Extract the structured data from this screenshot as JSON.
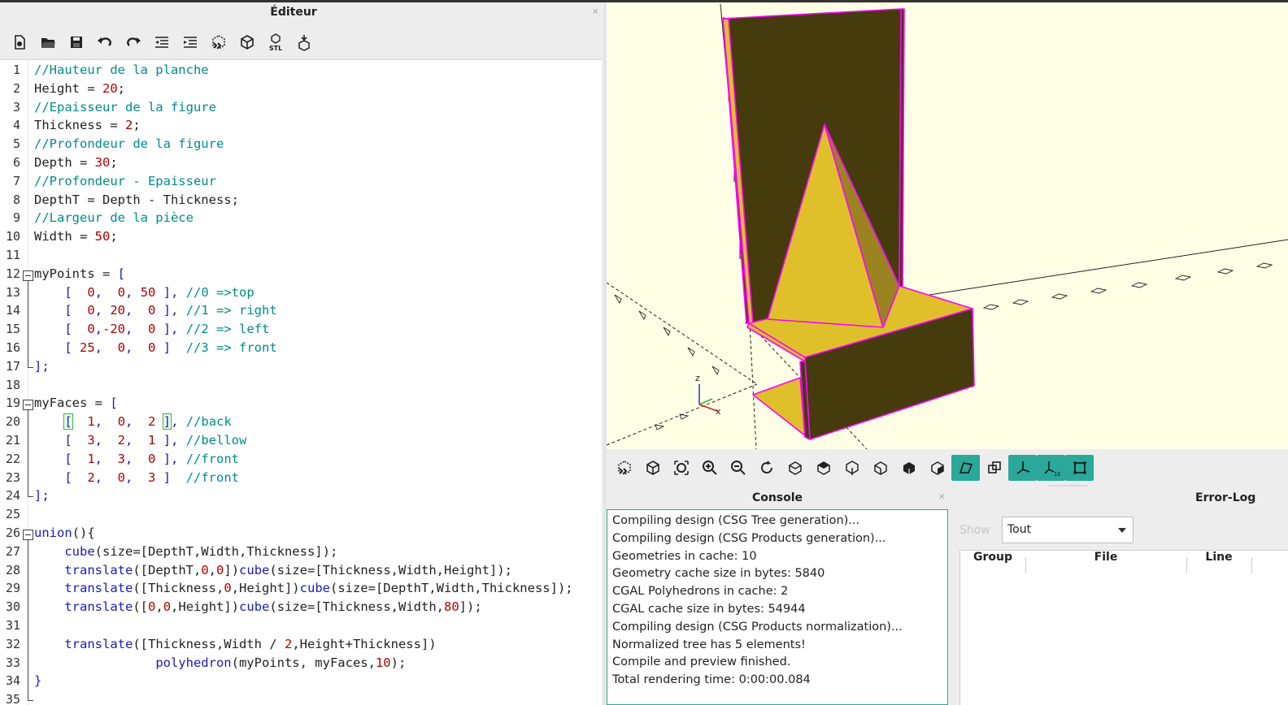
{
  "editor": {
    "title": "Éditeur",
    "close": "×",
    "toolbar": [
      "new-file-icon",
      "open-file-icon",
      "save-icon",
      "undo-icon",
      "redo-icon",
      "unindent-icon",
      "indent-icon",
      "preview-icon",
      "render-icon",
      "export-stl-icon",
      "send-to-print-icon"
    ],
    "stl_label": "STL",
    "lines": [
      {
        "n": "1",
        "segs": [
          [
            "cmt",
            "//Hauteur de la planche"
          ]
        ]
      },
      {
        "n": "2",
        "segs": [
          [
            "",
            "Height = "
          ],
          [
            "num",
            "20"
          ],
          [
            "",
            ";"
          ]
        ]
      },
      {
        "n": "3",
        "segs": [
          [
            "cmt",
            "//Epaisseur de la figure"
          ]
        ]
      },
      {
        "n": "4",
        "segs": [
          [
            "",
            "Thickness = "
          ],
          [
            "num",
            "2"
          ],
          [
            "",
            ";"
          ]
        ]
      },
      {
        "n": "5",
        "segs": [
          [
            "cmt",
            "//Profondeur de la figure"
          ]
        ]
      },
      {
        "n": "6",
        "segs": [
          [
            "",
            "Depth = "
          ],
          [
            "num",
            "30"
          ],
          [
            "",
            ";"
          ]
        ]
      },
      {
        "n": "7",
        "segs": [
          [
            "cmt",
            "//Profondeur - Epaisseur"
          ]
        ]
      },
      {
        "n": "8",
        "segs": [
          [
            "",
            "DepthT = Depth - Thickness;"
          ]
        ]
      },
      {
        "n": "9",
        "segs": [
          [
            "cmt",
            "//Largeur de la pièce"
          ]
        ]
      },
      {
        "n": "10",
        "segs": [
          [
            "",
            "Width = "
          ],
          [
            "num",
            "50"
          ],
          [
            "",
            ";"
          ]
        ]
      },
      {
        "n": "11",
        "segs": []
      },
      {
        "n": "12",
        "segs": [
          [
            "",
            "myPoints = "
          ],
          [
            "kw",
            "["
          ]
        ]
      },
      {
        "n": "13",
        "segs": [
          [
            "",
            "    "
          ],
          [
            "kw",
            "[  "
          ],
          [
            "num",
            "0"
          ],
          [
            "kw",
            ",  "
          ],
          [
            "num",
            "0"
          ],
          [
            "kw",
            ", "
          ],
          [
            "num",
            "50"
          ],
          [
            "kw",
            " ], "
          ],
          [
            "cmt",
            "//0 =>top"
          ]
        ]
      },
      {
        "n": "14",
        "segs": [
          [
            "",
            "    "
          ],
          [
            "kw",
            "[  "
          ],
          [
            "num",
            "0"
          ],
          [
            "kw",
            ", "
          ],
          [
            "num",
            "20"
          ],
          [
            "kw",
            ",  "
          ],
          [
            "num",
            "0"
          ],
          [
            "kw",
            " ], "
          ],
          [
            "cmt",
            "//1 => right"
          ]
        ]
      },
      {
        "n": "15",
        "segs": [
          [
            "",
            "    "
          ],
          [
            "kw",
            "[  "
          ],
          [
            "num",
            "0"
          ],
          [
            "kw",
            ","
          ],
          [
            "num",
            "-20"
          ],
          [
            "kw",
            ",  "
          ],
          [
            "num",
            "0"
          ],
          [
            "kw",
            " ], "
          ],
          [
            "cmt",
            "//2 => left"
          ]
        ]
      },
      {
        "n": "16",
        "segs": [
          [
            "",
            "    "
          ],
          [
            "kw",
            "[ "
          ],
          [
            "num",
            "25"
          ],
          [
            "kw",
            ",  "
          ],
          [
            "num",
            "0"
          ],
          [
            "kw",
            ",  "
          ],
          [
            "num",
            "0"
          ],
          [
            "kw",
            " ]  "
          ],
          [
            "cmt",
            "//3 => front"
          ]
        ]
      },
      {
        "n": "17",
        "segs": [
          [
            "kw",
            "];"
          ]
        ]
      },
      {
        "n": "18",
        "segs": []
      },
      {
        "n": "19",
        "segs": [
          [
            "",
            "myFaces = "
          ],
          [
            "kw",
            "["
          ]
        ]
      },
      {
        "n": "20",
        "segs": [
          [
            "",
            "    "
          ],
          [
            "kw hl",
            "["
          ],
          [
            "kw",
            "  "
          ],
          [
            "num",
            "1"
          ],
          [
            "kw",
            ",  "
          ],
          [
            "num",
            "0"
          ],
          [
            "kw",
            ",  "
          ],
          [
            "num",
            "2"
          ],
          [
            "kw",
            " "
          ],
          [
            "kw hl",
            "]"
          ],
          [
            "kw",
            ", "
          ],
          [
            "cmt",
            "//back"
          ]
        ]
      },
      {
        "n": "21",
        "segs": [
          [
            "",
            "    "
          ],
          [
            "kw",
            "[  "
          ],
          [
            "num",
            "3"
          ],
          [
            "kw",
            ",  "
          ],
          [
            "num",
            "2"
          ],
          [
            "kw",
            ",  "
          ],
          [
            "num",
            "1"
          ],
          [
            "kw",
            " ], "
          ],
          [
            "cmt",
            "//bellow"
          ]
        ]
      },
      {
        "n": "22",
        "segs": [
          [
            "",
            "    "
          ],
          [
            "kw",
            "[  "
          ],
          [
            "num",
            "1"
          ],
          [
            "kw",
            ",  "
          ],
          [
            "num",
            "3"
          ],
          [
            "kw",
            ",  "
          ],
          [
            "num",
            "0"
          ],
          [
            "kw",
            " ], "
          ],
          [
            "cmt",
            "//front"
          ]
        ]
      },
      {
        "n": "23",
        "segs": [
          [
            "",
            "    "
          ],
          [
            "kw",
            "[  "
          ],
          [
            "num",
            "2"
          ],
          [
            "kw",
            ",  "
          ],
          [
            "num",
            "0"
          ],
          [
            "kw",
            ",  "
          ],
          [
            "num",
            "3"
          ],
          [
            "kw",
            " ]  "
          ],
          [
            "cmt",
            "//front"
          ]
        ]
      },
      {
        "n": "24",
        "segs": [
          [
            "kw",
            "];"
          ]
        ]
      },
      {
        "n": "25",
        "segs": []
      },
      {
        "n": "26",
        "segs": [
          [
            "kw",
            "union"
          ],
          [
            "",
            "(){"
          ]
        ]
      },
      {
        "n": "27",
        "segs": [
          [
            "",
            "    "
          ],
          [
            "kw",
            "cube"
          ],
          [
            "",
            "(size=[DepthT,Width,Thickness]);"
          ]
        ]
      },
      {
        "n": "28",
        "segs": [
          [
            "",
            "    "
          ],
          [
            "kw",
            "translate"
          ],
          [
            "",
            "([DepthT,"
          ],
          [
            "num",
            "0"
          ],
          [
            "",
            ","
          ],
          [
            "num",
            "0"
          ],
          [
            "",
            "])"
          ],
          [
            "kw",
            "cube"
          ],
          [
            "",
            "(size=[Thickness,Width,Height]);"
          ]
        ]
      },
      {
        "n": "29",
        "segs": [
          [
            "",
            "    "
          ],
          [
            "kw",
            "translate"
          ],
          [
            "",
            "([Thickness,"
          ],
          [
            "num",
            "0"
          ],
          [
            "",
            ",Height])"
          ],
          [
            "kw",
            "cube"
          ],
          [
            "",
            "(size=[DepthT,Width,Thickness]);"
          ]
        ]
      },
      {
        "n": "30",
        "segs": [
          [
            "",
            "    "
          ],
          [
            "kw",
            "translate"
          ],
          [
            "",
            "(["
          ],
          [
            "num",
            "0"
          ],
          [
            "",
            ","
          ],
          [
            "num",
            "0"
          ],
          [
            "",
            ",Height])"
          ],
          [
            "kw",
            "cube"
          ],
          [
            "",
            "(size=[Thickness,Width,"
          ],
          [
            "num",
            "80"
          ],
          [
            "",
            "]);"
          ]
        ]
      },
      {
        "n": "31",
        "segs": []
      },
      {
        "n": "32",
        "segs": [
          [
            "",
            "    "
          ],
          [
            "kw",
            "translate"
          ],
          [
            "",
            "([Thickness,Width / "
          ],
          [
            "num",
            "2"
          ],
          [
            "",
            ",Height+Thickness])"
          ]
        ]
      },
      {
        "n": "33",
        "segs": [
          [
            "",
            "                "
          ],
          [
            "kw",
            "polyhedron"
          ],
          [
            "",
            "(myPoints, myFaces,"
          ],
          [
            "num",
            "10"
          ],
          [
            "",
            ");"
          ]
        ]
      },
      {
        "n": "34",
        "segs": [
          [
            "kw",
            "}"
          ]
        ]
      },
      {
        "n": "35",
        "segs": []
      }
    ]
  },
  "view_toolbar": [
    "preview-icon",
    "render-icon",
    "view-all-icon",
    "zoom-in-icon",
    "zoom-out-icon",
    "reset-view-icon",
    "view-right-icon",
    "view-top-icon",
    "view-bottom-icon",
    "view-left-icon",
    "view-front-icon",
    "view-back-icon",
    "perspective-icon",
    "orthogonal-icon",
    "show-axes-icon",
    "show-scale-markers-icon",
    "show-edges-icon"
  ],
  "view_toolbar_active": [
    "perspective-icon",
    "show-axes-icon",
    "show-scale-markers-icon",
    "show-edges-icon"
  ],
  "axis_labels": {
    "z": "z",
    "x": "x",
    "scale_ten": "10"
  },
  "console": {
    "title": "Console",
    "close": "×",
    "lines": [
      "Compiling design (CSG Tree generation)...",
      "Compiling design (CSG Products generation)...",
      "Geometries in cache: 10",
      "Geometry cache size in bytes: 5840",
      "CGAL Polyhedrons in cache: 2",
      "CGAL cache size in bytes: 54944",
      "Compiling design (CSG Products normalization)...",
      "Normalized tree has 5 elements!",
      "Compile and preview finished.",
      "Total rendering time: 0:00:00.084"
    ]
  },
  "errorlog": {
    "title": "Error-Log",
    "show_label": "Show",
    "show_value": "Tout",
    "columns": [
      "Group",
      "File",
      "Line"
    ]
  },
  "colors": {
    "viewport_bg": "#ffffe5",
    "face_light": "#e0c02a",
    "face_dark": "#453b0c",
    "edge": "#ff00ff",
    "accent": "#2aa89a"
  }
}
